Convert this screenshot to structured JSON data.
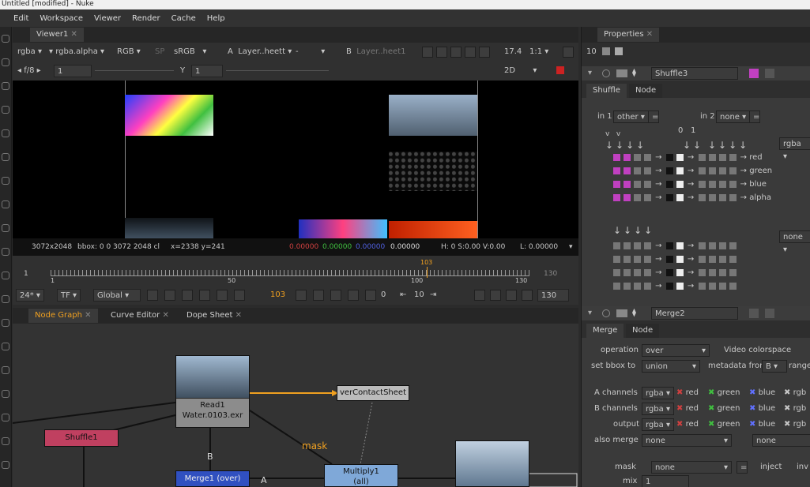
{
  "app": {
    "title": "Untitled [modified] - Nuke"
  },
  "menu": [
    "Edit",
    "Workspace",
    "Viewer",
    "Render",
    "Cache",
    "Help"
  ],
  "viewer": {
    "tab": "Viewer1",
    "channels": "rgba",
    "channel_alpha": "rgba.alpha",
    "colorspace_mode": "RGB",
    "lut": "sRGB",
    "a_label": "A",
    "a_input": "Layer..heett",
    "a_op": "-",
    "b_label": "B",
    "b_input": "Layer..heet1",
    "fstop": "17.4",
    "zoom": "1:1",
    "fstop_label": "f/8",
    "frame_field": "1",
    "y_label": "Y",
    "y_field": "1",
    "mode_2d": "2D",
    "status_res": "3072x2048",
    "status_bbox": "bbox: 0 0 3072 2048 cl",
    "status_xy": "x=2338 y=241",
    "status_r": "0.00000",
    "status_g": "0.00000",
    "status_b": "0.00000",
    "status_a": "0.00000",
    "status_hsv": "H: 0 S:0.00 V:0.00",
    "status_l": "L: 0.00000"
  },
  "timeline": {
    "start": "1",
    "end": "130",
    "current": "103",
    "ticks": [
      "1",
      "50",
      "100",
      "130"
    ],
    "fps": "24*",
    "tf": "TF",
    "range": "Global",
    "frame_display": "103",
    "step": "10",
    "end_field": "130",
    "inc_field": "0"
  },
  "graph_tabs": [
    "Node Graph",
    "Curve Editor",
    "Dope Sheet"
  ],
  "nodes": {
    "read": {
      "name": "Read1",
      "file": "Water.0103.exr"
    },
    "shuffle": {
      "name": "Shuffle1"
    },
    "contact": {
      "name": "verContactSheet"
    },
    "merge": {
      "name": "Merge1 (over)"
    },
    "multiply": {
      "name": "Multiply1",
      "sub": "(all)"
    },
    "label_b": "B",
    "label_a": "A",
    "label_mask": "mask"
  },
  "properties": {
    "tab": "Properties",
    "max_panels": "10",
    "shuffle_panel": {
      "name": "Shuffle3",
      "tabs": [
        "Shuffle",
        "Node"
      ],
      "in1_label": "in 1",
      "in1_value": "other",
      "in2_label": "in 2",
      "in2_value": "none",
      "col_0": "0",
      "col_1": "1",
      "out_layer": "rgba",
      "out_layer2": "none",
      "out_channels": [
        "red",
        "green",
        "blue",
        "alpha"
      ]
    },
    "merge_panel": {
      "name": "Merge2",
      "tabs": [
        "Merge",
        "Node"
      ],
      "operation_label": "operation",
      "operation_value": "over",
      "video_colorspace": "Video colorspace",
      "set_bbox_label": "set bbox to",
      "set_bbox_value": "union",
      "metadata_label": "metadata from",
      "metadata_value": "B",
      "range_label": "range",
      "a_channels_label": "A channels",
      "a_channels_value": "rgba",
      "b_channels_label": "B channels",
      "b_channels_value": "rgba",
      "output_label": "output",
      "output_value": "rgba",
      "ch_red": "red",
      "ch_green": "green",
      "ch_blue": "blue",
      "ch_rgba": "rgb",
      "also_merge_label": "also merge",
      "also_merge_value": "none",
      "also_merge_value2": "none",
      "mask_label": "mask",
      "mask_value": "none",
      "inject_label": "inject",
      "invert_label": "inv",
      "mix_label": "mix",
      "mix_value": "1"
    }
  },
  "colors": {
    "accent": "#f0a020",
    "shuffle_node": "#c04060",
    "merge_node": "#3050c0",
    "multiply_node": "#7fa8d8",
    "pink": "#c040c0"
  }
}
